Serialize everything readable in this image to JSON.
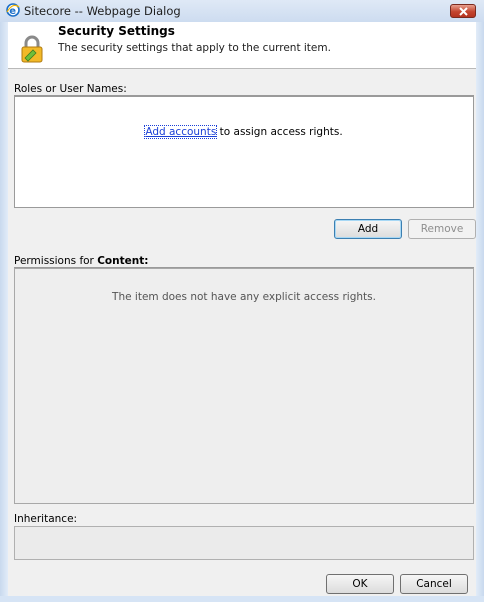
{
  "window": {
    "title": "Sitecore -- Webpage Dialog"
  },
  "header": {
    "title": "Security Settings",
    "subtitle": "The security settings that apply to the current item."
  },
  "roles": {
    "label": "Roles or User Names:",
    "link_text": "Add accounts",
    "message_rest": " to assign access rights."
  },
  "actions": {
    "add_label": "Add",
    "remove_label": "Remove"
  },
  "permissions": {
    "label_prefix": "Permissions for ",
    "label_item": "Content:",
    "empty_message": "The item does not have any explicit access rights."
  },
  "inheritance": {
    "label": "Inheritance:"
  },
  "footer": {
    "ok_label": "OK",
    "cancel_label": "Cancel"
  },
  "icons": {
    "window_icon": "internet-explorer-icon",
    "close_icon": "close-icon",
    "header_icon": "lock-icon"
  },
  "colors": {
    "link": "#1a3fd6",
    "close_button": "#c4452f"
  }
}
